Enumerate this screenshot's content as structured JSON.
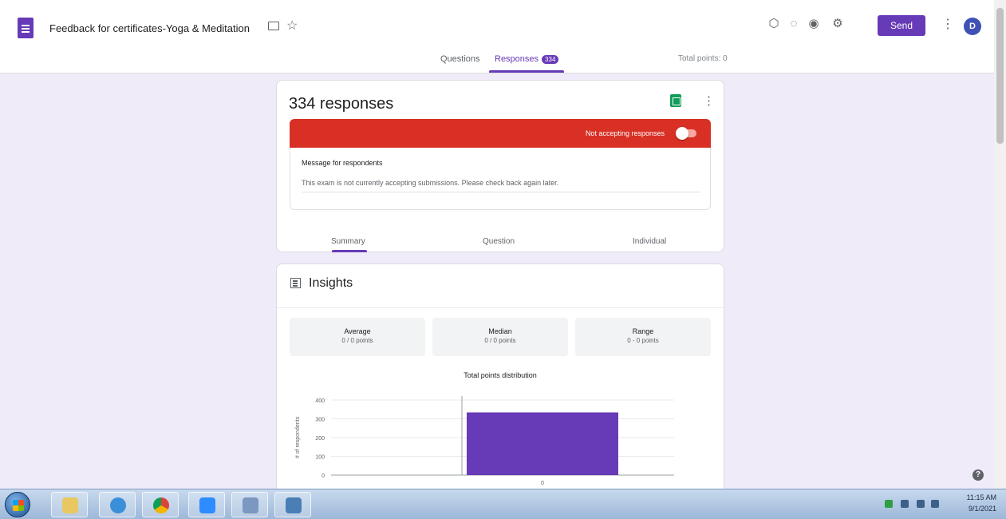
{
  "header": {
    "form_title": "Feedback for certificates-Yoga & Meditation",
    "send_label": "Send",
    "avatar_letter": "D",
    "tabs": [
      {
        "label": "Questions"
      },
      {
        "label": "Responses",
        "badge": "334"
      }
    ],
    "total_points": "Total points: 0"
  },
  "responses_card": {
    "count_label": "334 responses",
    "accepting_label": "Not accepting responses",
    "accepting": false,
    "message_label": "Message for respondents",
    "message_text": "This exam is not currently accepting submissions. Please check back again later.",
    "subtabs": [
      {
        "label": "Summary"
      },
      {
        "label": "Question"
      },
      {
        "label": "Individual"
      }
    ]
  },
  "insights": {
    "title": "Insights",
    "stats": [
      {
        "label": "Average",
        "value": "0 / 0 points"
      },
      {
        "label": "Median",
        "value": "0 / 0 points"
      },
      {
        "label": "Range",
        "value": "0 - 0 points"
      }
    ]
  },
  "chart_data": {
    "type": "bar",
    "title": "Total points distribution",
    "ylabel": "# of respondents",
    "categories": [
      "0"
    ],
    "values": [
      334
    ],
    "ylim": [
      0,
      400
    ],
    "yticks": [
      "0",
      "100",
      "200",
      "300",
      "400"
    ],
    "bar_color": "#673ab7"
  },
  "colors": {
    "accent": "#673ab7",
    "banner": "#d93025",
    "background": "#f0ebf8"
  },
  "taskbar": {
    "apps": [
      "windows-explorer",
      "internet-explorer",
      "chrome",
      "zoom",
      "tool",
      "media"
    ],
    "time": "11:15 AM",
    "date": "9/1/2021"
  }
}
